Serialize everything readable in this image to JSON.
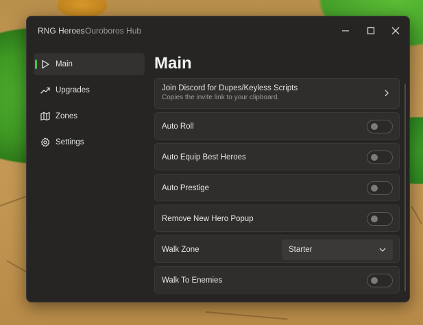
{
  "window": {
    "title": "RNG Heroes",
    "subtitle": "Ouroboros Hub",
    "controls": [
      "minimize-icon",
      "maximize-icon",
      "close-icon"
    ]
  },
  "sidebar": {
    "items": [
      {
        "label": "Main",
        "icon": "play-icon",
        "active": true
      },
      {
        "label": "Upgrades",
        "icon": "trending-up-icon",
        "active": false
      },
      {
        "label": "Zones",
        "icon": "map-icon",
        "active": false
      },
      {
        "label": "Settings",
        "icon": "gear-icon",
        "active": false
      }
    ]
  },
  "main": {
    "title": "Main",
    "discord": {
      "label": "Join Discord for Dupes/Keyless Scripts",
      "description": "Copies the invite link to your clipboard."
    },
    "toggles": [
      {
        "label": "Auto Roll",
        "on": false
      },
      {
        "label": "Auto Equip Best Heroes",
        "on": false
      },
      {
        "label": "Auto Prestige",
        "on": false
      },
      {
        "label": "Remove New Hero Popup",
        "on": false
      }
    ],
    "walk_zone": {
      "label": "Walk Zone",
      "value": "Starter"
    },
    "walk_to_enemies": {
      "label": "Walk To Enemies",
      "on": false
    }
  },
  "colors": {
    "accent": "#48c341",
    "window_bg": "#262523",
    "card_bg": "#2f2e2c"
  }
}
